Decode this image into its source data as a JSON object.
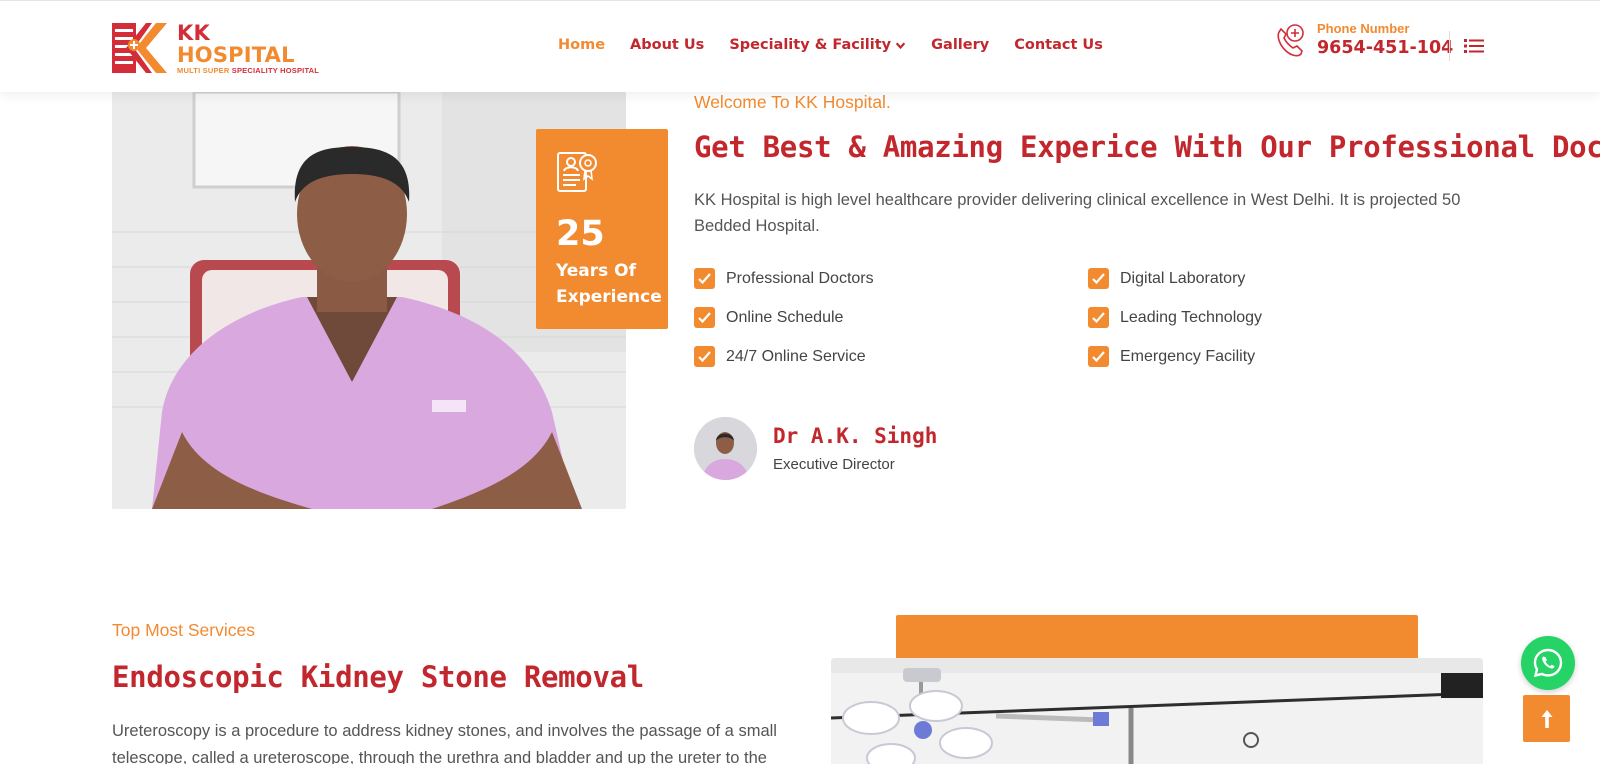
{
  "brand": {
    "name_part1": "KK",
    "name_part2": "HOSPITAL",
    "tagline_part1": "MULTI SUPER",
    "tagline_part2": "SPECIALITY HOSPITAL"
  },
  "nav": {
    "items": [
      {
        "label": "Home",
        "active": true
      },
      {
        "label": "About Us"
      },
      {
        "label": "Speciality & Facility",
        "dropdown": true
      },
      {
        "label": "Gallery"
      },
      {
        "label": "Contact Us"
      }
    ]
  },
  "contact": {
    "label": "Phone Number",
    "number": "9654-451-104"
  },
  "experience": {
    "years": "25",
    "label_line1": "Years Of",
    "label_line2": "Experience"
  },
  "about": {
    "welcome": "Welcome To KK Hospital.",
    "title": "Get Best & Amazing Experice With Our Professional Doctors",
    "intro": "KK Hospital is high level healthcare provider delivering clinical excellence in West Delhi. It is projected 50 Bedded Hospital.",
    "features": [
      "Professional Doctors",
      "Digital Laboratory",
      "Online Schedule",
      "Leading Technology",
      "24/7 Online Service",
      "Emergency Facility"
    ]
  },
  "doctor": {
    "name": "Dr A.K. Singh",
    "role": "Executive Director"
  },
  "services": {
    "subtitle": "Top Most Services",
    "title": "Endoscopic Kidney Stone Removal",
    "text": "Ureteroscopy is a procedure to address kidney stones, and involves the passage of a small telescope, called a ureteroscope, through the urethra and bladder and up the ureter to the"
  },
  "colors": {
    "primary_red": "#c2272d",
    "accent_orange": "#f28a30",
    "whatsapp_green": "#25d366"
  }
}
